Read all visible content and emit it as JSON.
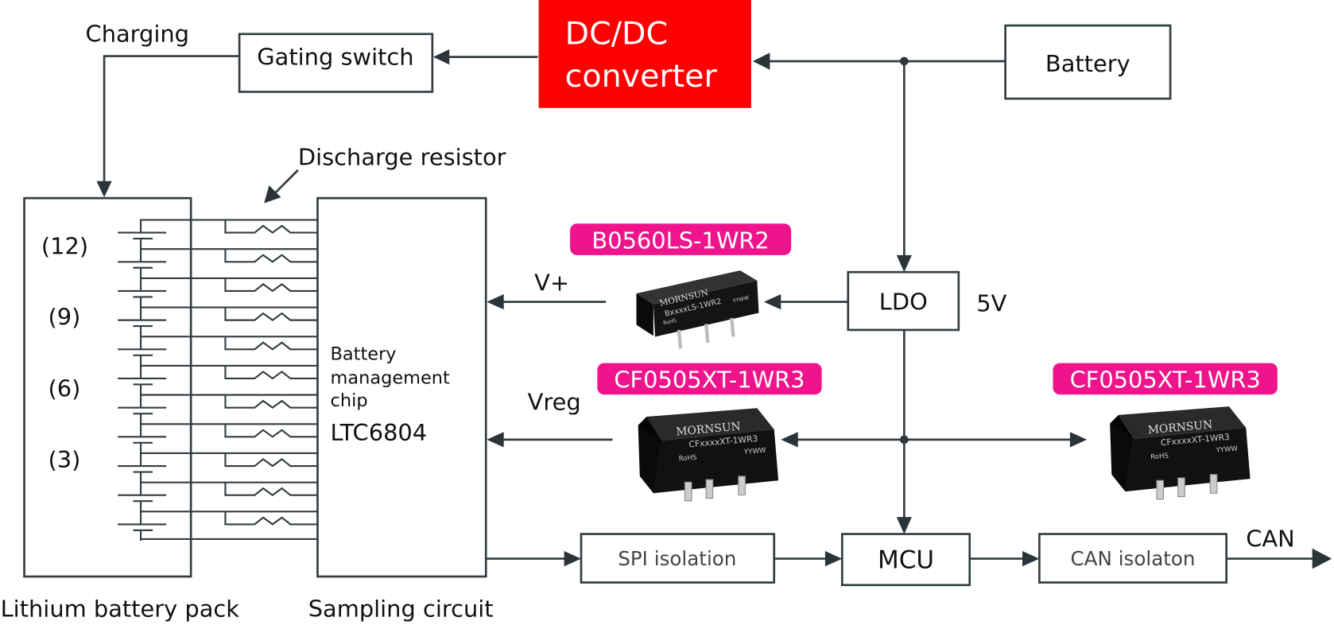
{
  "colors": {
    "line": "#333d42",
    "dcdc_fill": "#ff0000",
    "label_fill": "#f0148c",
    "module_body": "#111111"
  },
  "labels": {
    "charging": "Charging",
    "gating_switch": "Gating switch",
    "dcdc_line1": "DC/DC",
    "dcdc_line2": "converter",
    "battery": "Battery",
    "discharge_resistor": "Discharge resistor",
    "cell_12": "(12)",
    "cell_9": "(9)",
    "cell_6": "(6)",
    "cell_3": "(3)",
    "chip_line1": "Battery",
    "chip_line2": "management",
    "chip_line3": "chip",
    "chip_model": "LTC6804",
    "lithium_pack": "Lithium battery pack",
    "sampling_circuit": "Sampling circuit",
    "vplus": "V+",
    "vreg": "Vreg",
    "ldo": "LDO",
    "five_v": "5V",
    "mcu": "MCU",
    "spi_isolation": "SPI isolation",
    "can_isolation": "CAN isolaton",
    "can": "CAN"
  },
  "products": [
    {
      "label": "B0560LS-1WR2",
      "brand": "MORNSUN",
      "marking": "BxxxxLS-1WR2",
      "rohs": "RoHS",
      "date": "YYWW"
    },
    {
      "label": "CF0505XT-1WR3",
      "brand": "MORNSUN",
      "marking": "CFxxxxXT-1WR3",
      "rohs": "RoHS",
      "date": "YYWW"
    },
    {
      "label": "CF0505XT-1WR3",
      "brand": "MORNSUN",
      "marking": "CFxxxxXT-1WR3",
      "rohs": "RoHS",
      "date": "YYWW"
    }
  ],
  "cell_count": 11
}
